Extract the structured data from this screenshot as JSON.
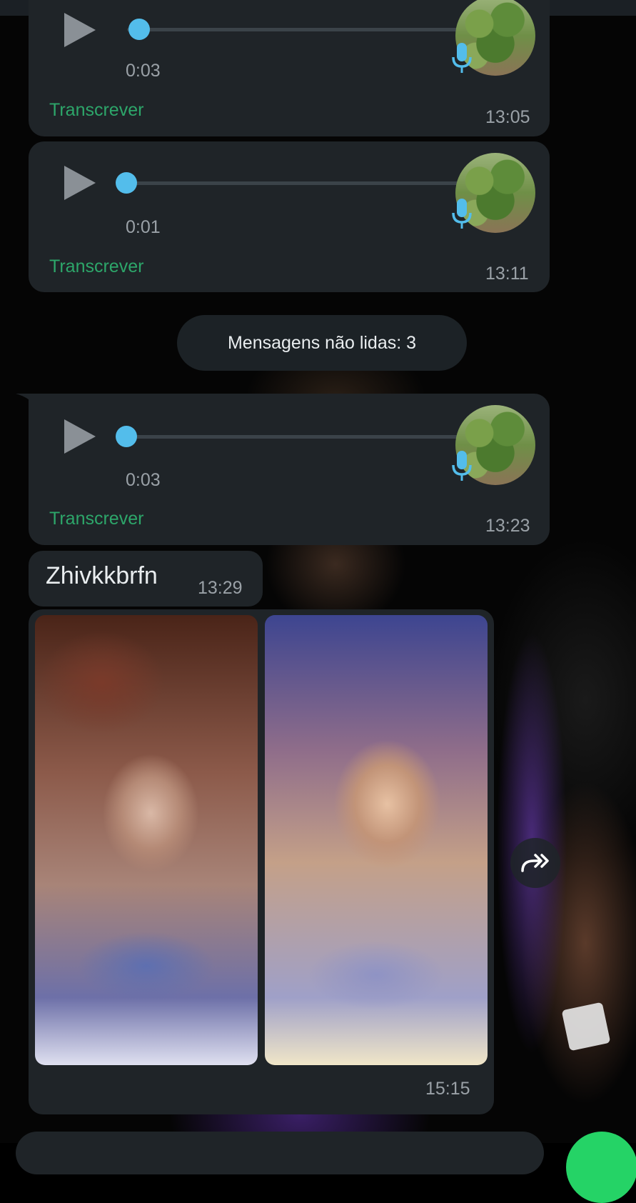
{
  "messages": [
    {
      "type": "voice",
      "duration": "0:03",
      "progress": 0.04,
      "transcribe_label": "Transcrever",
      "time": "13:05",
      "icon": "mic-icon"
    },
    {
      "type": "voice",
      "duration": "0:01",
      "progress": 0.0,
      "transcribe_label": "Transcrever",
      "time": "13:11",
      "icon": "mic-icon"
    },
    {
      "type": "voice",
      "duration": "0:03",
      "progress": 0.0,
      "transcribe_label": "Transcrever",
      "time": "13:23",
      "icon": "mic-icon"
    },
    {
      "type": "text",
      "text": "Zhivkkbrfn",
      "time": "13:29"
    },
    {
      "type": "album",
      "photo_count": 2,
      "time": "15:15"
    }
  ],
  "unread_banner": "Mensagens não lidas: 3",
  "colors": {
    "bubble": "#1f2428",
    "accent_blue": "#53bdeb",
    "transcribe_green": "#2da66a",
    "fab_green": "#25d366"
  },
  "icons": {
    "play": "play-icon",
    "mic": "mic-icon",
    "forward": "forward-icon"
  }
}
